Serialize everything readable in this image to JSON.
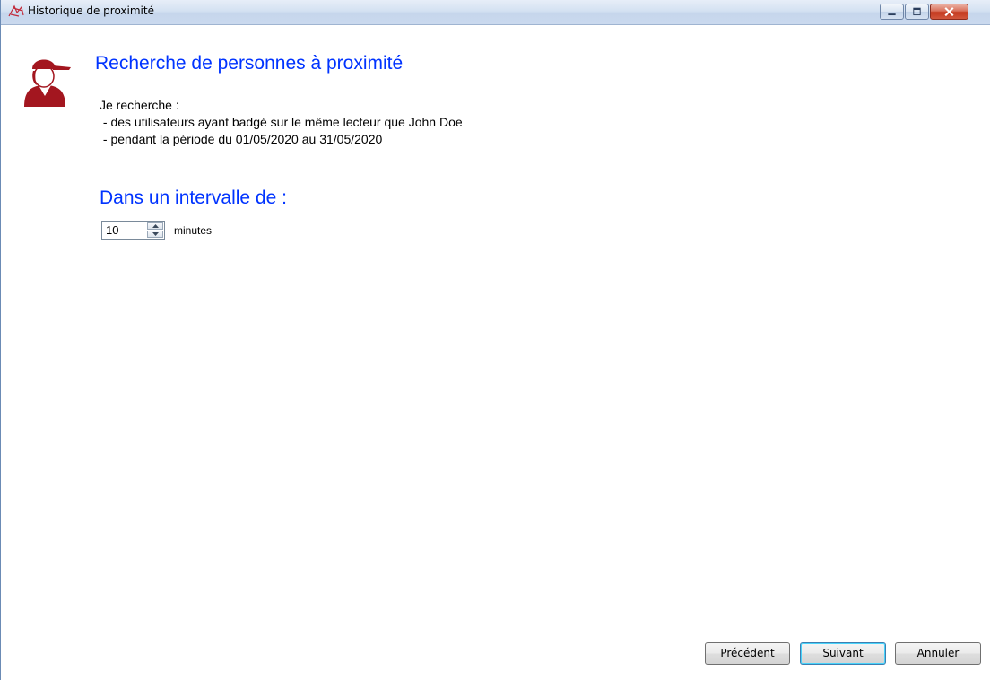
{
  "window": {
    "title": "Historique de proximité",
    "app_icon": "proximity-app-icon",
    "controls": [
      "minimize-icon",
      "maximize-icon",
      "close-icon"
    ]
  },
  "header": {
    "icon": "user-cap-icon",
    "title": "Recherche de personnes à proximité"
  },
  "description": {
    "lines": [
      "Je recherche :",
      " - des utilisateurs ayant badgé sur le même lecteur que John Doe",
      " - pendant la période du 01/05/2020 au 31/05/2020"
    ]
  },
  "interval": {
    "heading": "Dans un intervalle de :",
    "value": "10",
    "unit": "minutes"
  },
  "footer": {
    "previous_label": "Précédent",
    "next_label": "Suivant",
    "cancel_label": "Annuler"
  },
  "colors": {
    "heading": "#0033ff",
    "icon_red": "#a3161f"
  }
}
